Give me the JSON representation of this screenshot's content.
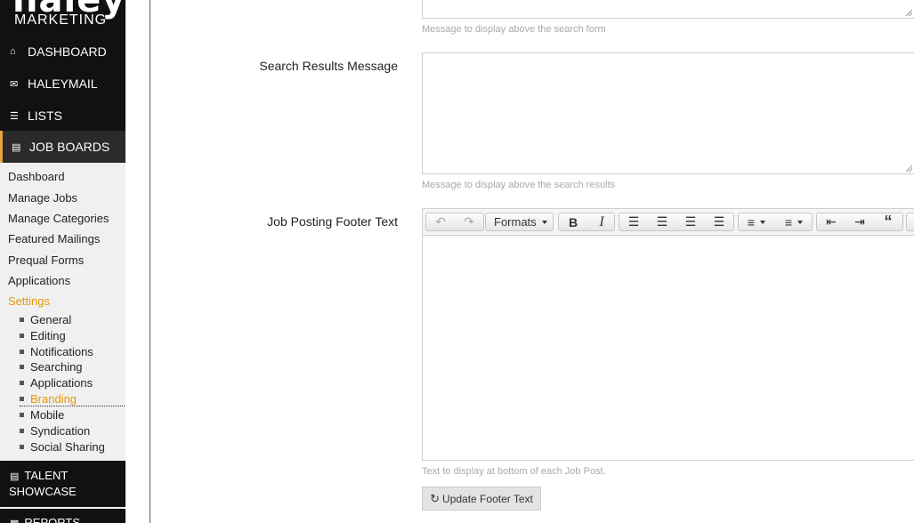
{
  "brand": {
    "logo_top": "haley",
    "logo_bottom": "MARKETING"
  },
  "nav": {
    "dashboard": "DASHBOARD",
    "haleymail": "HALEYMAIL",
    "lists": "LISTS",
    "job_boards": "JOB BOARDS",
    "talent_showcase_1": "TALENT",
    "talent_showcase_2": "SHOWCASE",
    "reports": "REPORTS"
  },
  "job_boards_menu": [
    "Dashboard",
    "Manage Jobs",
    "Manage Categories",
    "Featured Mailings",
    "Prequal Forms",
    "Applications",
    "Settings"
  ],
  "settings_menu": [
    "General",
    "Editing",
    "Notifications",
    "Searching",
    "Applications",
    "Branding",
    "Mobile",
    "Syndication",
    "Social Sharing"
  ],
  "active_setting": "Branding",
  "form": {
    "search_form_help": "Message to display above the search form",
    "search_results_label": "Search Results Message",
    "search_results_value": "",
    "search_results_help": "Message to display above the search results",
    "footer_label": "Job Posting Footer Text",
    "footer_value": "",
    "footer_help": "Text to display at bottom of each Job Post.",
    "update_button": "Update Footer Text"
  },
  "editor": {
    "formats_label": "Formats"
  },
  "colors": {
    "accent": "#e8960e",
    "sidebar_dark": "#111111",
    "border": "#55598a"
  }
}
